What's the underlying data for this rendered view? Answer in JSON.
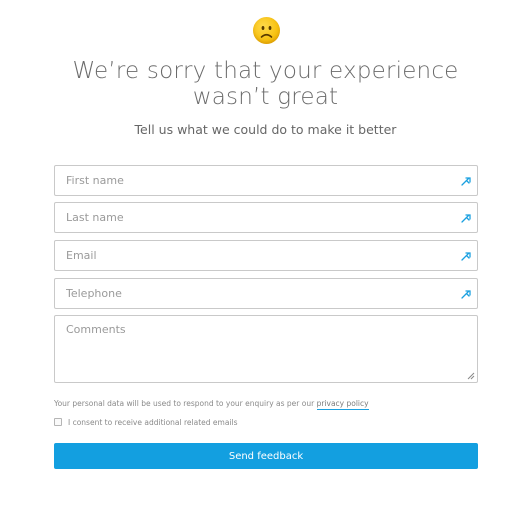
{
  "header": {
    "title": "We’re sorry that your experience wasn’t great",
    "subtitle": "Tell us what we could do to make it better"
  },
  "form": {
    "first_name": {
      "placeholder": "First name",
      "value": ""
    },
    "last_name": {
      "placeholder": "Last name",
      "value": ""
    },
    "email": {
      "placeholder": "Email",
      "value": ""
    },
    "telephone": {
      "placeholder": "Telephone",
      "value": ""
    },
    "comments": {
      "placeholder": "Comments",
      "value": ""
    },
    "privacy_text": "Your personal data will be used to respond to your enquiry as per our",
    "privacy_link": "privacy policy",
    "consent_label": "I consent to receive additional related emails",
    "consent_checked": false,
    "submit_label": "Send feedback"
  },
  "icons": {
    "emoji": "sad-face-icon",
    "field_icon": "autofill-key-icon"
  },
  "colors": {
    "accent": "#139fe0",
    "emoji": "#f7c10f",
    "border": "#c9c9c9"
  }
}
